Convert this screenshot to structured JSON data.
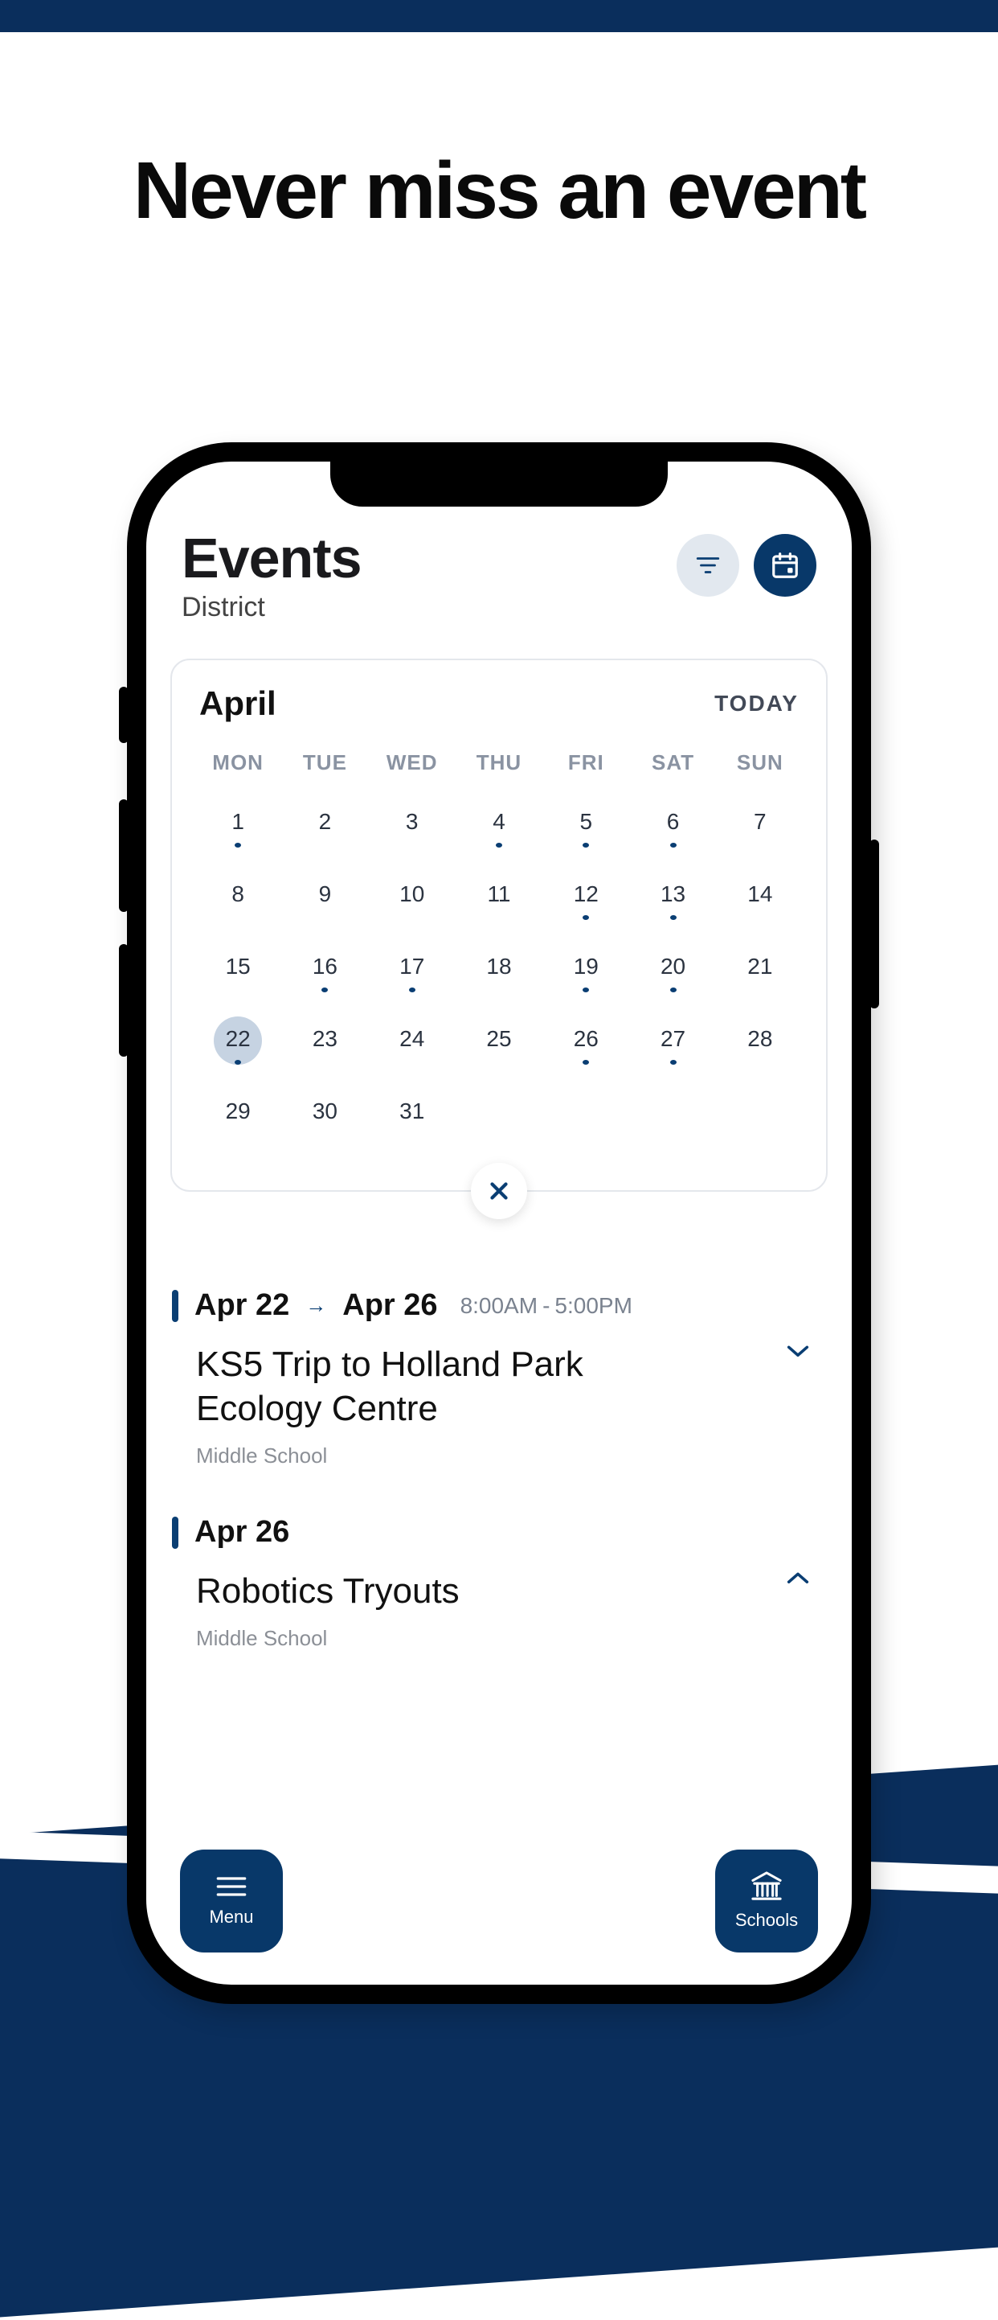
{
  "hero": {
    "headline": "Never miss an event"
  },
  "header": {
    "title": "Events",
    "subtitle": "District"
  },
  "calendar": {
    "month": "April",
    "todayLabel": "TODAY",
    "weekdays": [
      "MON",
      "TUE",
      "WED",
      "THU",
      "FRI",
      "SAT",
      "SUN"
    ],
    "weeks": [
      [
        {
          "n": "1",
          "dot": true
        },
        {
          "n": "2"
        },
        {
          "n": "3"
        },
        {
          "n": "4",
          "dot": true
        },
        {
          "n": "5",
          "dot": true
        },
        {
          "n": "6",
          "dot": true
        },
        {
          "n": "7"
        }
      ],
      [
        {
          "n": "8"
        },
        {
          "n": "9"
        },
        {
          "n": "10"
        },
        {
          "n": "11"
        },
        {
          "n": "12",
          "dot": true
        },
        {
          "n": "13",
          "dot": true
        },
        {
          "n": "14"
        }
      ],
      [
        {
          "n": "15"
        },
        {
          "n": "16",
          "dot": true
        },
        {
          "n": "17",
          "dot": true
        },
        {
          "n": "18"
        },
        {
          "n": "19",
          "dot": true
        },
        {
          "n": "20",
          "dot": true
        },
        {
          "n": "21"
        }
      ],
      [
        {
          "n": "22",
          "dot": true,
          "selected": true
        },
        {
          "n": "23"
        },
        {
          "n": "24"
        },
        {
          "n": "25"
        },
        {
          "n": "26",
          "dot": true
        },
        {
          "n": "27",
          "dot": true
        },
        {
          "n": "28"
        }
      ],
      [
        {
          "n": "29"
        },
        {
          "n": "30"
        },
        {
          "n": "31"
        },
        {
          "n": ""
        },
        {
          "n": ""
        },
        {
          "n": ""
        },
        {
          "n": ""
        }
      ]
    ]
  },
  "events": [
    {
      "dateStart": "Apr 22",
      "dateEnd": "Apr 26",
      "timeStart": "8:00AM",
      "timeEnd": "5:00PM",
      "title": "KS5 Trip to Holland Park Ecology Centre",
      "school": "Middle School",
      "expanded": false
    },
    {
      "dateStart": "Apr 26",
      "title": "Robotics Tryouts",
      "school": "Middle School",
      "expanded": true
    }
  ],
  "bottom": {
    "menu": "Menu",
    "schools": "Schools"
  }
}
